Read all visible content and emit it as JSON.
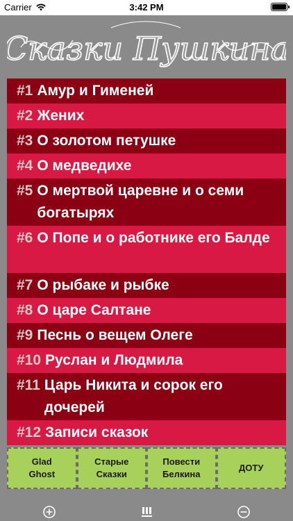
{
  "status": {
    "carrier": "Carrier",
    "time": "3:42 PM"
  },
  "header": {
    "title": "Сказки Пушкина"
  },
  "stories": [
    {
      "num": "#1",
      "title": "Амур и Гименей",
      "shade": "dark"
    },
    {
      "num": "#2",
      "title": "Жених",
      "shade": "light"
    },
    {
      "num": "#3",
      "title": "О золотом петушке",
      "shade": "dark"
    },
    {
      "num": "#4",
      "title": "О медведихе",
      "shade": "light"
    },
    {
      "num": "#5",
      "title": "О мертвой царевне и о семи богатырях",
      "shade": "dark"
    },
    {
      "num": "#6",
      "title": "О Попе и о работнике его Балде",
      "shade": "light"
    },
    {
      "num": "#7",
      "title": "О рыбаке и рыбке",
      "shade": "dark"
    },
    {
      "num": "#8",
      "title": "О царе Салтане",
      "shade": "light"
    },
    {
      "num": "#9",
      "title": "Песнь о вещем Олеге",
      "shade": "dark"
    },
    {
      "num": "#10",
      "title": "Руслан и Людмила",
      "shade": "light"
    },
    {
      "num": "#11",
      "title": "Царь Никита и сорок его дочерей",
      "shade": "dark"
    },
    {
      "num": "#12",
      "title": "Записи сказок",
      "shade": "light"
    }
  ],
  "tabs": [
    {
      "label": "Glad\nGhost"
    },
    {
      "label": "Старые\nСказки"
    },
    {
      "label": "Повести\nБелкина"
    },
    {
      "label": "ДОТУ"
    }
  ],
  "bottom": {
    "left_icon": "plus-circle-icon",
    "center_icon": "menu-bars-icon",
    "right_icon": "minus-circle-icon"
  },
  "colors": {
    "dark_row": "#8b0012",
    "light_row": "#d81944",
    "tab_bg": "#a7d15a",
    "background": "#8a8a8a"
  }
}
